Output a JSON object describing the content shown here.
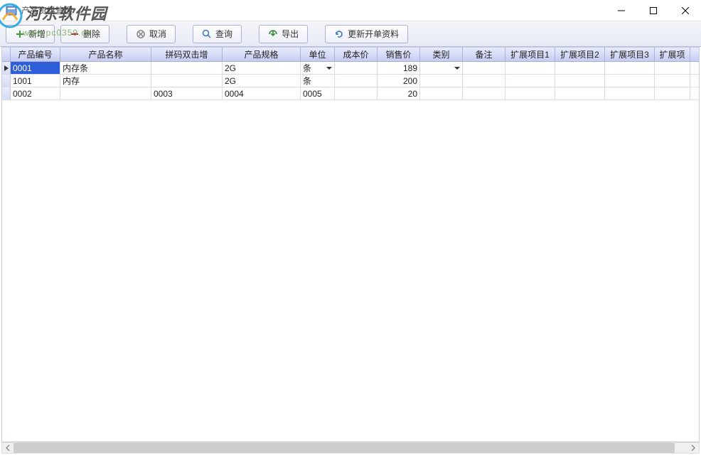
{
  "window": {
    "title": "产品资料管理"
  },
  "watermark": {
    "brand": "河东软件园",
    "url": "www.pc0359.cn"
  },
  "toolbar": {
    "add": "新增",
    "delete": "删除",
    "cancel": "取消",
    "query": "查询",
    "export": "导出",
    "refresh": "更新开单资料"
  },
  "columns": [
    "产品编号",
    "产品名称",
    "拼码双击增",
    "产品规格",
    "单位",
    "成本价",
    "销售价",
    "类别",
    "备注",
    "扩展项目1",
    "扩展项目2",
    "扩展项目3",
    "扩展项"
  ],
  "rows": [
    {
      "id": "0001",
      "name": "内存条",
      "py": "",
      "spec": "2G",
      "unit": "条",
      "cost": "",
      "price": "189",
      "cat": "",
      "remark": "",
      "e1": "",
      "e2": "",
      "e3": "",
      "e4": "",
      "active": true,
      "unitDropdown": true,
      "catDropdown": true
    },
    {
      "id": "1001",
      "name": "内存",
      "py": "",
      "spec": "2G",
      "unit": "条",
      "cost": "",
      "price": "200",
      "cat": "",
      "remark": "",
      "e1": "",
      "e2": "",
      "e3": "",
      "e4": "",
      "active": false
    },
    {
      "id": "0002",
      "name": "",
      "py": "0003",
      "spec": "0004",
      "unit": "0005",
      "cost": "",
      "price": "20",
      "cat": "",
      "remark": "",
      "e1": "",
      "e2": "",
      "e3": "",
      "e4": "",
      "active": false
    }
  ]
}
